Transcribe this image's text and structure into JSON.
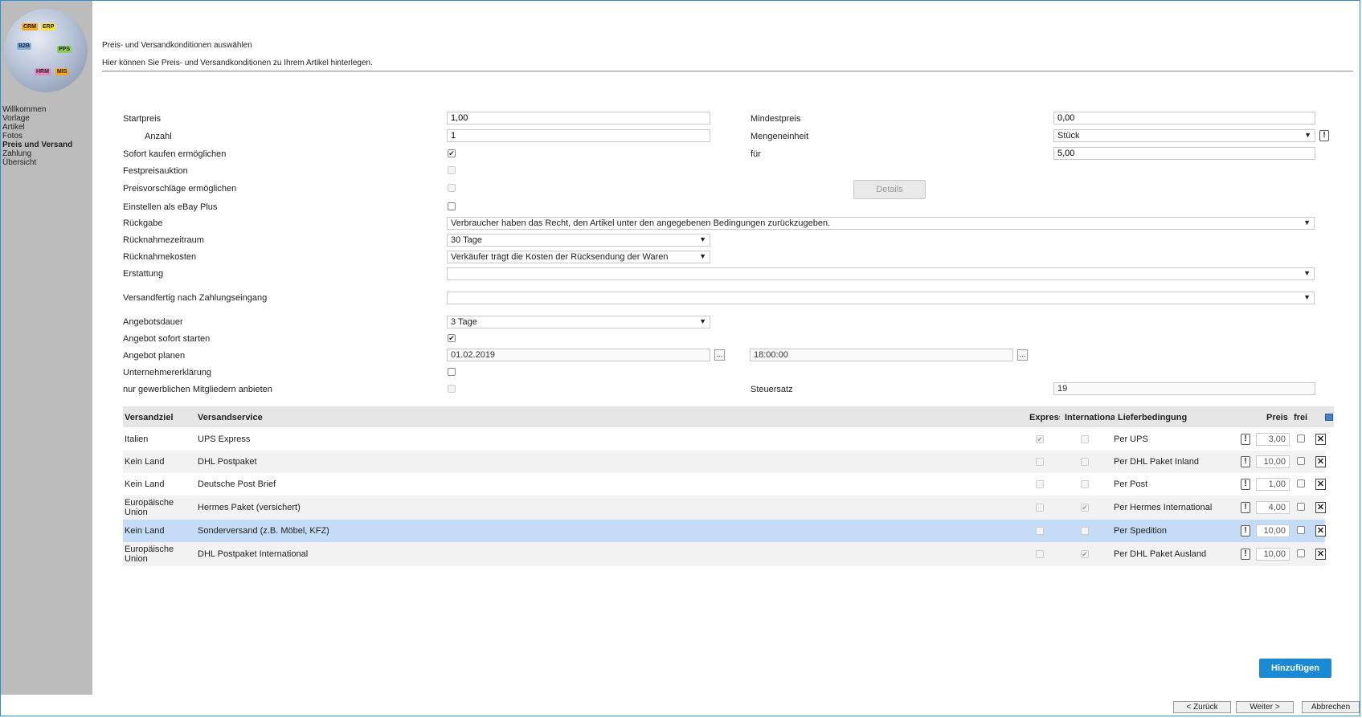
{
  "sidebar": {
    "logo_labels": [
      "CRM",
      "ERP",
      "B2B",
      "PPS",
      "HRM",
      "MIS"
    ],
    "items": [
      {
        "label": "Willkommen",
        "active": false
      },
      {
        "label": "Vorlage",
        "active": false
      },
      {
        "label": "Artikel",
        "active": false
      },
      {
        "label": "Fotos",
        "active": false
      },
      {
        "label": "Preis und Versand",
        "active": true
      },
      {
        "label": "Zahlung",
        "active": false
      },
      {
        "label": "Übersicht",
        "active": false
      }
    ]
  },
  "header": {
    "title": "Preis- und Versandkonditionen auswählen",
    "subtitle": "Hier können Sie Preis- und Versandkonditionen zu Ihrem Artikel hinterlegen."
  },
  "form": {
    "startpreis": {
      "label": "Startpreis",
      "value": "1,00"
    },
    "anzahl": {
      "label": "Anzahl",
      "value": "1"
    },
    "sofort_kaufen": {
      "label": "Sofort kaufen ermöglichen",
      "checked": true
    },
    "festpreis": {
      "label": "Festpreisauktion",
      "checked": false
    },
    "preisvorschlaege": {
      "label": "Preisvorschläge ermöglichen",
      "checked": false
    },
    "ebay_plus": {
      "label": "Einstellen als eBay Plus",
      "checked": false
    },
    "rueckgabe": {
      "label": "Rückgabe",
      "value": "Verbraucher haben das Recht, den Artikel unter den angegebenen Bedingungen zurückzugeben."
    },
    "ruecknahmezeitraum": {
      "label": "Rücknahmezeitraum",
      "value": "30 Tage"
    },
    "ruecknahmekosten": {
      "label": "Rücknahmekosten",
      "value": "Verkäufer trägt die Kosten der Rücksendung der Waren"
    },
    "erstattung": {
      "label": "Erstattung",
      "value": ""
    },
    "versandfertig": {
      "label": "Versandfertig nach Zahlungseingang",
      "value": ""
    },
    "angebotsdauer": {
      "label": "Angebotsdauer",
      "value": "3 Tage"
    },
    "sofort_starten": {
      "label": "Angebot sofort starten",
      "checked": true
    },
    "angebot_planen": {
      "label": "Angebot planen",
      "date": "01.02.2019",
      "time": "18:00:00"
    },
    "unternehmer": {
      "label": "Unternehmererklärung",
      "checked": false
    },
    "gewerblich": {
      "label": "nur gewerblichen Mitgliedern anbieten",
      "checked": false
    },
    "mindestpreis": {
      "label": "Mindestpreis",
      "value": "0,00"
    },
    "mengeneinheit": {
      "label": "Mengeneinheit",
      "value": "Stück"
    },
    "fuer": {
      "label": "für",
      "value": "5,00"
    },
    "details_label": "Details",
    "steuersatz": {
      "label": "Steuersatz",
      "value": "19"
    }
  },
  "table": {
    "headers": {
      "versandziel": "Versandziel",
      "versandservice": "Versandservice",
      "express": "Express",
      "international": "International",
      "lieferbedingung": "Lieferbedingung",
      "preis": "Preis",
      "frei": "frei"
    },
    "rows": [
      {
        "ziel": "Italien",
        "service": "UPS Express",
        "express": true,
        "international": false,
        "liefer": "Per UPS",
        "preis": "3,00",
        "frei": false
      },
      {
        "ziel": "Kein Land",
        "service": "DHL Postpaket",
        "express": false,
        "international": false,
        "liefer": "Per DHL Paket Inland",
        "preis": "10,00",
        "frei": false
      },
      {
        "ziel": "Kein Land",
        "service": "Deutsche Post Brief",
        "express": false,
        "international": false,
        "liefer": "Per Post",
        "preis": "1,00",
        "frei": false
      },
      {
        "ziel": "Europäische Union",
        "service": "Hermes Paket (versichert)",
        "express": false,
        "international": true,
        "liefer": "Per Hermes International",
        "preis": "4,00",
        "frei": false
      },
      {
        "ziel": "Kein Land",
        "service": "Sonderversand (z.B. Möbel, KFZ)",
        "express": false,
        "international": false,
        "liefer": "Per Spedition",
        "preis": "10,00",
        "frei": false,
        "selected": true
      },
      {
        "ziel": "Europäische Union",
        "service": "DHL Postpaket International",
        "express": false,
        "international": true,
        "liefer": "Per DHL Paket Ausland",
        "preis": "10,00",
        "frei": false
      }
    ]
  },
  "buttons": {
    "hinzufuegen": "Hinzufügen",
    "zurueck": "< Zurück",
    "weiter": "Weiter >",
    "abbrechen": "Abbrechen"
  },
  "symbols": {
    "check": "✔",
    "arrow": "▼",
    "ellipsis": "...",
    "excl": "!",
    "close": "✕"
  },
  "colors": {
    "accent": "#1a8ad4",
    "sidebar": "#bcbcbc",
    "selected_row": "#c5dcf7"
  }
}
